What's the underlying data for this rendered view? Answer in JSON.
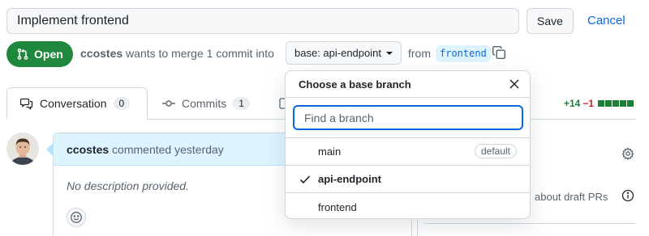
{
  "pr": {
    "title_value": "Implement frontend",
    "save_label": "Save",
    "cancel_label": "Cancel"
  },
  "status": {
    "state_label": "Open",
    "author": "ccostes",
    "merge_text": "wants to merge 1 commit into",
    "base_label": "base: api-endpoint",
    "from_text": "from",
    "head_branch": "frontend"
  },
  "tabs": [
    {
      "label": "Conversation",
      "count": "0"
    },
    {
      "label": "Commits",
      "count": "1"
    }
  ],
  "diffstat": {
    "additions": "+14",
    "deletions": "−1"
  },
  "comment": {
    "author": "ccostes",
    "action": "commented yesterday",
    "body": "No description provided."
  },
  "sidebar": {
    "draft_text": "about draft PRs"
  },
  "dropdown": {
    "title": "Choose a base branch",
    "filter_placeholder": "Find a branch",
    "items": [
      {
        "label": "main",
        "badge": "default",
        "selected": false
      },
      {
        "label": "api-endpoint",
        "badge": "",
        "selected": true
      },
      {
        "label": "frontend",
        "badge": "",
        "selected": false
      }
    ]
  },
  "colors": {
    "open_green": "#1f883d",
    "accent_blue": "#0969da",
    "diff_add": "#1a7f37",
    "diff_del": "#cf222e"
  }
}
